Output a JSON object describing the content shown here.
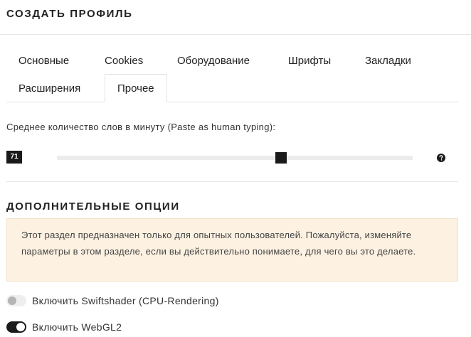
{
  "header": {
    "title": "СОЗДАТЬ ПРОФИЛЬ"
  },
  "tabs": [
    {
      "label": "Основные"
    },
    {
      "label": "Cookies"
    },
    {
      "label": "Оборудование"
    },
    {
      "label": "Шрифты"
    },
    {
      "label": "Закладки"
    },
    {
      "label": "Расширения"
    },
    {
      "label": "Прочее",
      "active": true
    }
  ],
  "typing_speed": {
    "label": "Среднее количество слов в минуту (Paste as human typing):",
    "value": "71",
    "slider_fraction": 0.63,
    "help_icon": "question-circle-icon"
  },
  "advanced": {
    "title": "ДОПОЛНИТЕЛЬНЫЕ ОПЦИИ",
    "warning": "Этот раздел предназначен только для опытных пользователей. Пожалуйста, изменяйте параметры в этом разделе, если вы действительно понимаете, для чего вы это делаете.",
    "warning_bg": "#fdf1e1",
    "options": [
      {
        "label": "Включить Swiftshader (CPU-Rendering)",
        "enabled": false
      },
      {
        "label": "Включить WebGL2",
        "enabled": true
      }
    ]
  }
}
